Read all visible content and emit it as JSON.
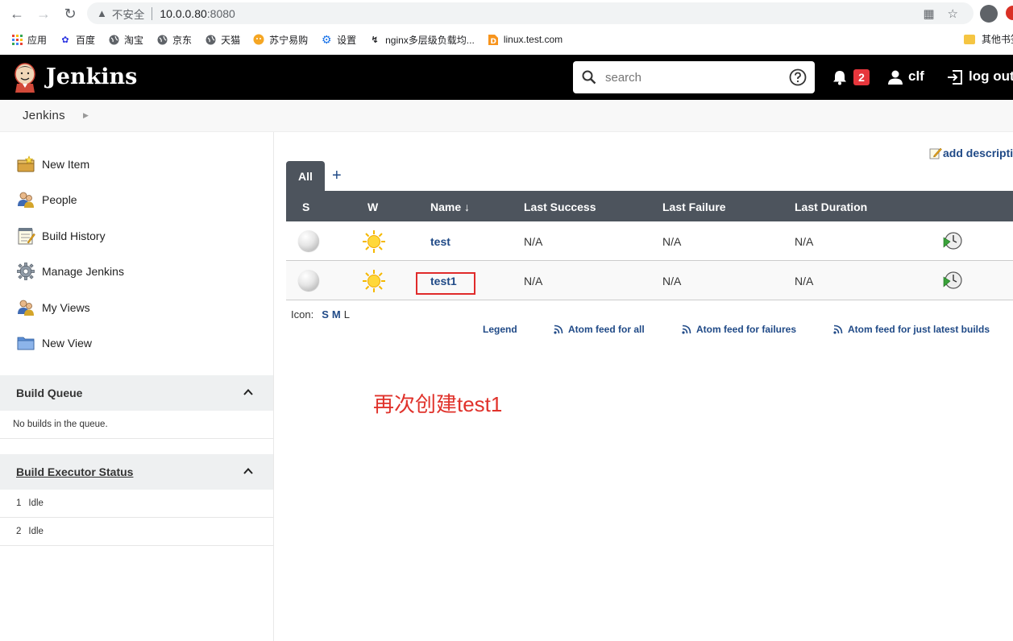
{
  "browser": {
    "insecure_label": "不安全",
    "url_host": "10.0.0.80",
    "url_port": ":8080",
    "bookmarks": [
      {
        "label": "应用",
        "icon": "apps-grid-icon"
      },
      {
        "label": "百度",
        "icon": "baidu-paw-icon"
      },
      {
        "label": "淘宝",
        "icon": "globe-icon"
      },
      {
        "label": "京东",
        "icon": "globe-icon"
      },
      {
        "label": "天猫",
        "icon": "globe-icon"
      },
      {
        "label": "苏宁易购",
        "icon": "suning-icon"
      },
      {
        "label": "设置",
        "icon": "gear-icon"
      },
      {
        "label": "nginx多层级负载均...",
        "icon": "nginx-icon"
      },
      {
        "label": "linux.test.com",
        "icon": "d-icon"
      }
    ],
    "other_bookmarks": "其他书签"
  },
  "header": {
    "title": "Jenkins",
    "search_placeholder": "search",
    "notification_count": "2",
    "user": "clf",
    "logout": "log out"
  },
  "breadcrumb": {
    "root": "Jenkins"
  },
  "sidebar": {
    "tasks": [
      {
        "label": "New Item",
        "icon": "new-item-icon"
      },
      {
        "label": "People",
        "icon": "people-icon"
      },
      {
        "label": "Build History",
        "icon": "notepad-icon"
      },
      {
        "label": "Manage Jenkins",
        "icon": "gear-icon"
      },
      {
        "label": "My Views",
        "icon": "people-icon"
      },
      {
        "label": "New View",
        "icon": "folder-icon"
      }
    ],
    "build_queue": {
      "title": "Build Queue",
      "empty": "No builds in the queue."
    },
    "executors": {
      "title": "Build Executor Status",
      "items": [
        {
          "num": "1",
          "status": "Idle"
        },
        {
          "num": "2",
          "status": "Idle"
        }
      ]
    }
  },
  "main": {
    "add_description": "add description",
    "tabs": [
      {
        "label": "All"
      }
    ],
    "add_tab": "+",
    "columns": [
      "S",
      "W",
      "Name ↓",
      "Last Success",
      "Last Failure",
      "Last Duration"
    ],
    "jobs": [
      {
        "name": "test",
        "last_success": "N/A",
        "last_failure": "N/A",
        "last_duration": "N/A"
      },
      {
        "name": "test1",
        "last_success": "N/A",
        "last_failure": "N/A",
        "last_duration": "N/A"
      }
    ],
    "icon_label": "Icon:",
    "icon_sizes": [
      "S",
      "M",
      "L"
    ],
    "legend": "Legend",
    "feeds": [
      "Atom feed for all",
      "Atom feed for failures",
      "Atom feed for just latest builds"
    ],
    "annotation": "再次创建test1"
  },
  "colors": {
    "header_bg": "#000000",
    "table_header_bg": "#4d545d",
    "link": "#204a87",
    "annotation": "#e0322b",
    "badge": "#e6363c"
  }
}
